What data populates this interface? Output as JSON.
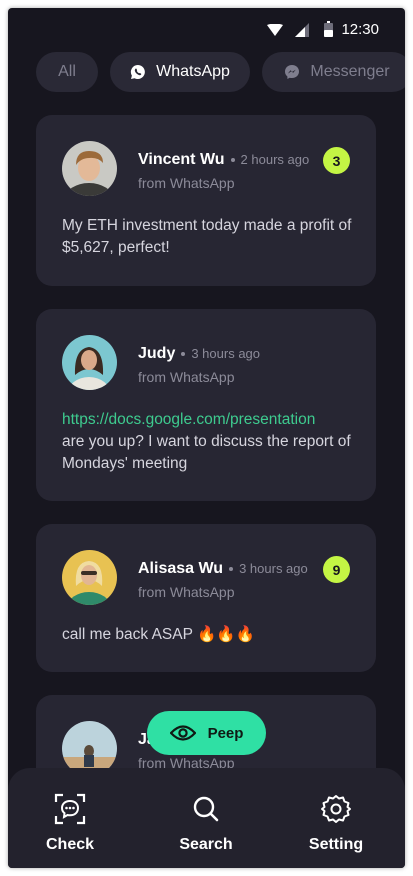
{
  "status_bar": {
    "time": "12:30"
  },
  "tabs": [
    {
      "label": "All",
      "active": false
    },
    {
      "label": "WhatsApp",
      "active": true,
      "icon": "whatsapp-icon"
    },
    {
      "label": "Messenger",
      "active": false,
      "icon": "messenger-icon"
    }
  ],
  "messages": [
    {
      "name": "Vincent Wu",
      "time": "2 hours ago",
      "source": "from WhatsApp",
      "badge": "3",
      "text": "My ETH investment today made a profit of $5,627, perfect!"
    },
    {
      "name": "Judy",
      "time": "3 hours ago",
      "source": "from WhatsApp",
      "link": "https://docs.google.com/presentation",
      "text": "are you up? I want to discuss the report of Mondays' meeting"
    },
    {
      "name": "Alisasa Wu",
      "time": "3 hours ago",
      "source": "from WhatsApp",
      "badge": "9",
      "text": "call me back ASAP 🔥🔥🔥"
    },
    {
      "name": "Ja",
      "source": "from WhatsApp"
    }
  ],
  "peep_button": {
    "label": "Peep"
  },
  "bottom_nav": [
    {
      "label": "Check",
      "icon": "scan-chat-icon"
    },
    {
      "label": "Search",
      "icon": "search-icon"
    },
    {
      "label": "Setting",
      "icon": "gear-icon"
    }
  ],
  "colors": {
    "background": "#17161f",
    "card": "#272633",
    "badge": "#c4f544",
    "accent": "#2fe0a4",
    "link": "#3ecb8f"
  }
}
